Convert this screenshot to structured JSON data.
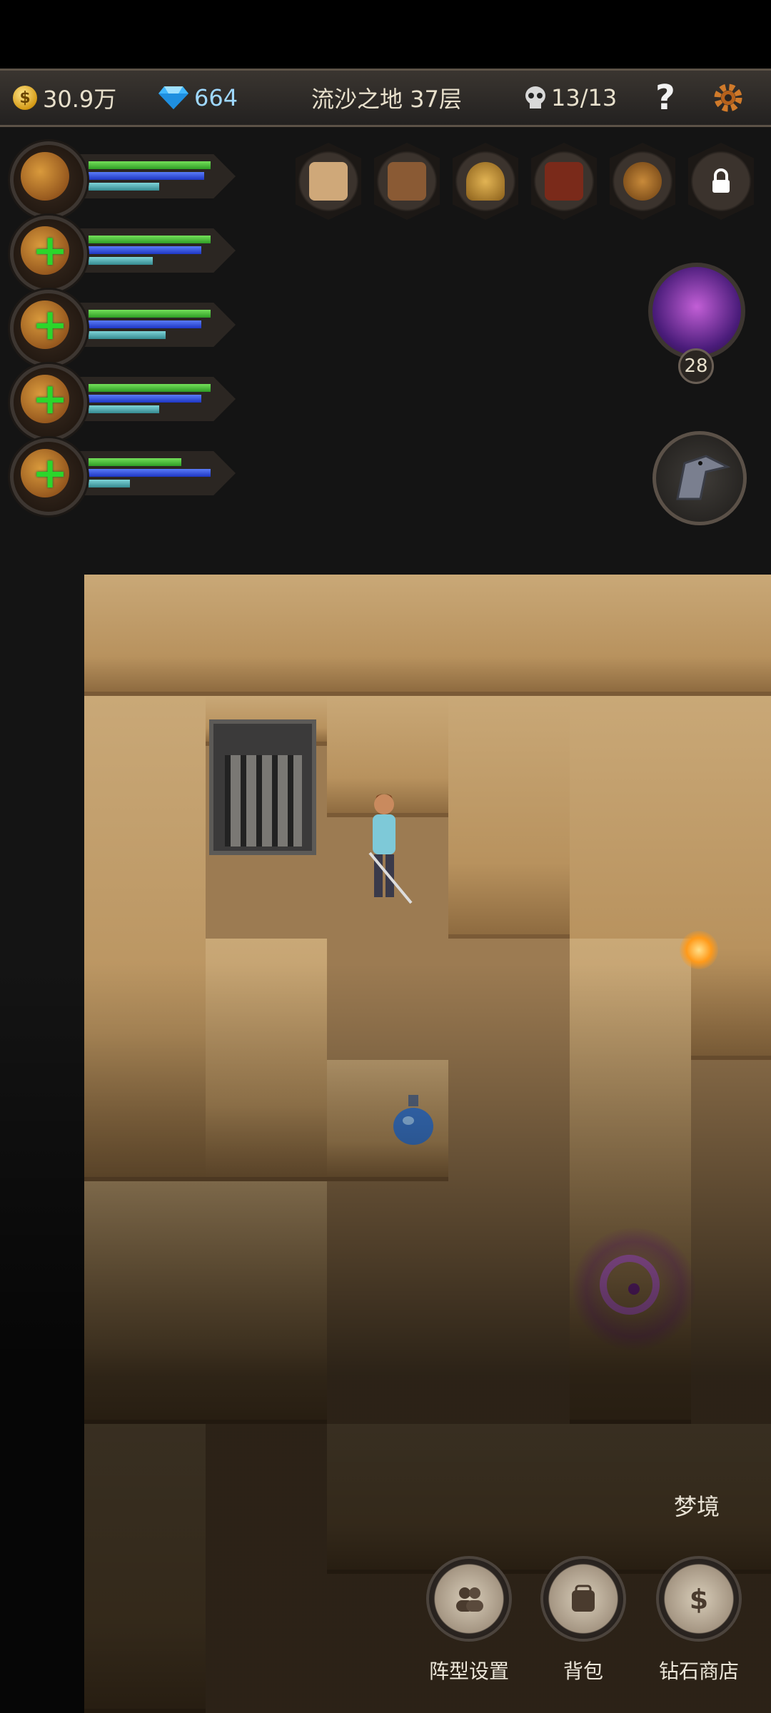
{
  "hud": {
    "gold": "30.9万",
    "diamonds": "664",
    "floor": "流沙之地 37层",
    "kills": "13/13",
    "help": "?"
  },
  "heroes": [
    {
      "hp": 0.95,
      "mp": 0.9,
      "sp": 0.55,
      "icon": "hero-portrait"
    },
    {
      "hp": 0.95,
      "mp": 0.88,
      "sp": 0.5,
      "icon": "heal-plus-icon"
    },
    {
      "hp": 0.95,
      "mp": 0.88,
      "sp": 0.6,
      "icon": "heal-plus-icon"
    },
    {
      "hp": 0.95,
      "mp": 0.88,
      "sp": 0.55,
      "icon": "heal-plus-icon"
    },
    {
      "hp": 0.72,
      "mp": 0.95,
      "sp": 0.32,
      "icon": "heal-plus-icon"
    }
  ],
  "items": [
    "dice-icon",
    "coffin-icon",
    "bell-icon",
    "book-icon",
    "acorn-icon",
    "lock-icon"
  ],
  "boss": {
    "level": "28"
  },
  "bottom": {
    "dream": "梦境",
    "formation": "阵型设置",
    "bag": "背包",
    "shop": "钻石商店"
  },
  "colors": {
    "hp": "#4ec43a",
    "mp": "#2c4fe0",
    "sp": "#5bb3b8",
    "portal": "#ea82f5"
  }
}
